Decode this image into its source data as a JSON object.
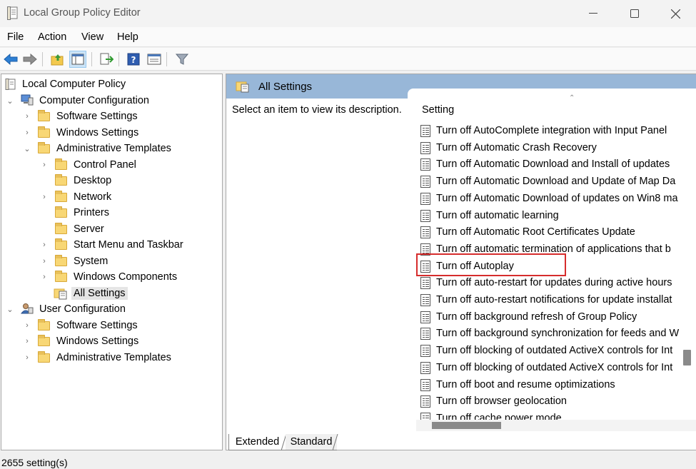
{
  "window": {
    "title": "Local Group Policy Editor",
    "minimize_glyph": "—",
    "maximize_glyph": "☐",
    "close_glyph": "✕"
  },
  "menu": [
    "File",
    "Action",
    "View",
    "Help"
  ],
  "toolbar": {
    "icons": [
      "back-arrow-icon",
      "forward-arrow-icon",
      "up-folder-icon",
      "show-hide-tree-icon",
      "export-list-icon",
      "help-icon",
      "properties-icon",
      "filter-icon"
    ]
  },
  "tree": {
    "root": "Local Computer Policy",
    "computer_config": "Computer Configuration",
    "cc_software": "Software Settings",
    "cc_windows": "Windows Settings",
    "cc_admin": "Administrative Templates",
    "at_control_panel": "Control Panel",
    "at_desktop": "Desktop",
    "at_network": "Network",
    "at_printers": "Printers",
    "at_server": "Server",
    "at_start_menu": "Start Menu and Taskbar",
    "at_system": "System",
    "at_windows_components": "Windows Components",
    "at_all_settings": "All Settings",
    "user_config": "User Configuration",
    "uc_software": "Software Settings",
    "uc_windows": "Windows Settings",
    "uc_admin": "Administrative Templates"
  },
  "right_pane": {
    "header_title": "All Settings",
    "description_prompt": "Select an item to view its description.",
    "column_header": "Setting",
    "settings": [
      "Turn off AutoComplete integration with Input Panel",
      "Turn off Automatic Crash Recovery",
      "Turn off Automatic Download and Install of updates",
      "Turn off Automatic Download and Update of Map Da",
      "Turn off Automatic Download of updates on Win8 ma",
      "Turn off automatic learning",
      "Turn off Automatic Root Certificates Update",
      "Turn off automatic termination of applications that b",
      "Turn off Autoplay",
      "Turn off auto-restart for updates during active hours",
      "Turn off auto-restart notifications for update installat",
      "Turn off background refresh of Group Policy",
      "Turn off background synchronization for feeds and W",
      "Turn off blocking of outdated ActiveX controls for Int",
      "Turn off blocking of outdated ActiveX controls for Int",
      "Turn off boot and resume optimizations",
      "Turn off browser geolocation",
      "Turn off cache power mode"
    ]
  },
  "tabs": {
    "extended": "Extended",
    "standard": "Standard"
  },
  "status": {
    "count": "2655 setting(s)"
  },
  "colors": {
    "header_blue": "#98b7d8",
    "highlight_red": "#d62c2c",
    "selected_bg": "#e5e5e5"
  }
}
